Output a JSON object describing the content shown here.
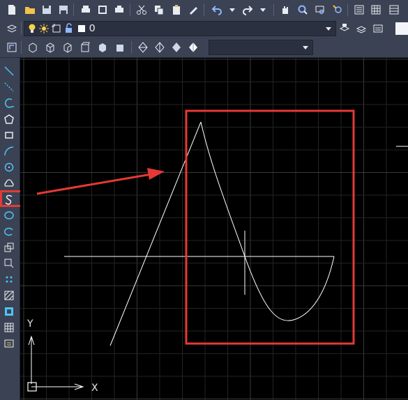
{
  "toolbar_row1": {
    "icons": [
      "new-file-icon",
      "open-folder-icon",
      "save-icon",
      "save-as-icon",
      "print-icon",
      "plot-preview-icon",
      "publish-icon",
      "cut-icon",
      "copy-icon",
      "paste-icon",
      "match-properties-icon",
      "undo-icon",
      "undo-dropdown-icon",
      "redo-icon",
      "redo-dropdown-icon",
      "pan-icon",
      "zoom-realtime-icon",
      "zoom-window-icon",
      "zoom-previous-icon",
      "properties-icon",
      "design-center-icon",
      "tool-palette-icon"
    ]
  },
  "toolbar_row2": {
    "layer_name": "0"
  },
  "toolbar_row3": {
    "style_value": ""
  },
  "axis": {
    "x_label": "X",
    "y_label": "Y"
  },
  "colors": {
    "accent_highlight": "#e53935",
    "grid": "#2c2c2c",
    "drawing": "#ffffff",
    "panel": "#3b4253"
  }
}
